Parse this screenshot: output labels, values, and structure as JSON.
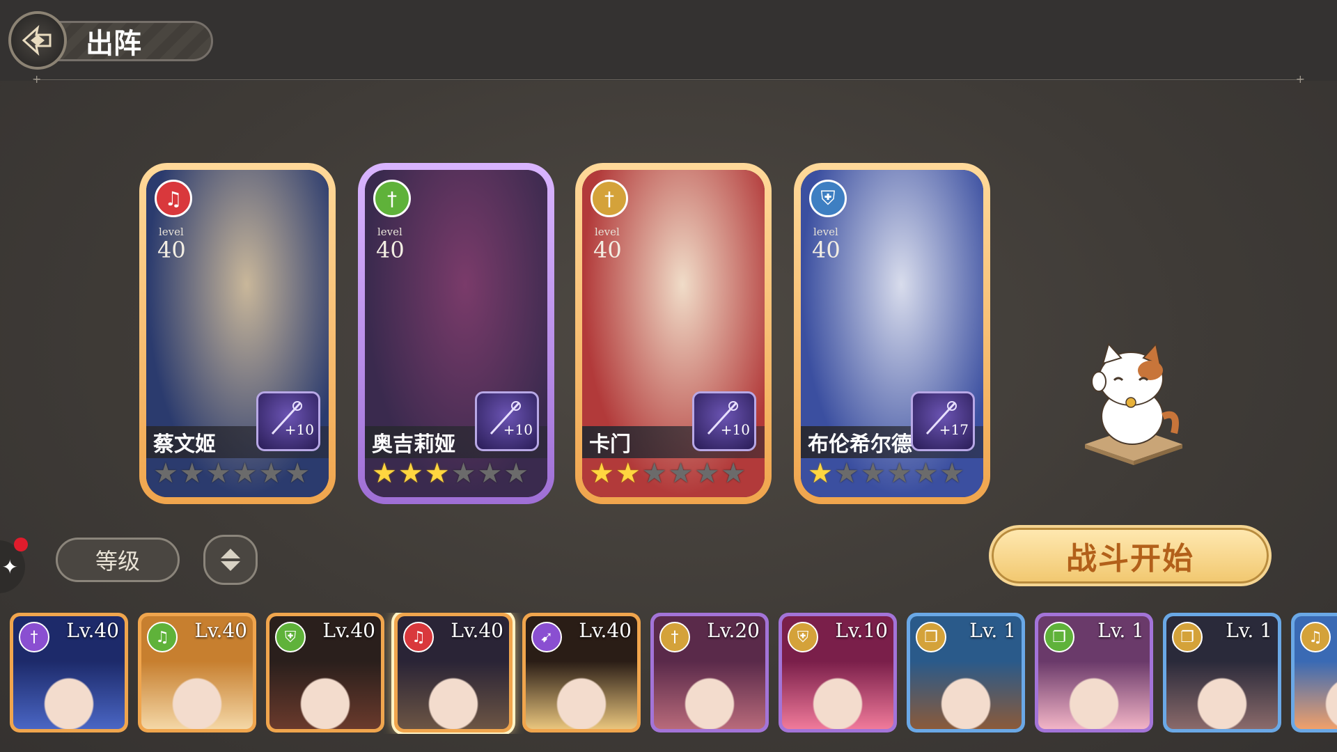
{
  "header": {
    "title": "出阵"
  },
  "team": [
    {
      "name": "蔡文姬",
      "level_word": "level",
      "level": "40",
      "class_icon": "lyre-icon",
      "class_color": "#d9383c",
      "frame": "gold",
      "weapon_plus": "+10",
      "stars_on": 0,
      "stars_total": 6,
      "art": [
        "#2b3b6e",
        "#c9b79a"
      ]
    },
    {
      "name": "奥吉莉娅",
      "level_word": "level",
      "level": "40",
      "class_icon": "sword-icon",
      "class_color": "#5fb23a",
      "frame": "purple",
      "weapon_plus": "+10",
      "stars_on": 3,
      "stars_total": 6,
      "art": [
        "#3a2a4e",
        "#7a3b6a"
      ]
    },
    {
      "name": "卡门",
      "level_word": "level",
      "level": "40",
      "class_icon": "sword-icon",
      "class_color": "#d4a23a",
      "frame": "gold",
      "weapon_plus": "+10",
      "stars_on": 2,
      "stars_total": 6,
      "art": [
        "#b23a3a",
        "#f0dcc8"
      ]
    },
    {
      "name": "布伦希尔德",
      "level_word": "level",
      "level": "40",
      "class_icon": "shield-icon",
      "class_color": "#3e7fc2",
      "frame": "gold",
      "weapon_plus": "+17",
      "stars_on": 1,
      "stars_total": 6,
      "art": [
        "#3b4fa0",
        "#d8dcec"
      ]
    }
  ],
  "controls": {
    "sort_label": "等级",
    "battle_label": "战斗开始"
  },
  "roster": [
    {
      "level": "Lv.40",
      "icon": "sword-icon",
      "icon_color": "#8a4fd1",
      "frame": "gold",
      "art": [
        "#1d2a6a",
        "#4a66c4"
      ]
    },
    {
      "level": "Lv.40",
      "icon": "lyre-icon",
      "icon_color": "#5fb23a",
      "frame": "gold",
      "art": [
        "#c77f2f",
        "#f4d7a6"
      ]
    },
    {
      "level": "Lv.40",
      "icon": "shield-icon",
      "icon_color": "#5fb23a",
      "frame": "gold",
      "art": [
        "#2a1f1c",
        "#6a3a2c"
      ]
    },
    {
      "level": "Lv.40",
      "icon": "lyre-icon",
      "icon_color": "#d9383c",
      "frame": "gold",
      "art": [
        "#2a2436",
        "#6c5544"
      ],
      "selected": true
    },
    {
      "level": "Lv.40",
      "icon": "bow-icon",
      "icon_color": "#8a4fd1",
      "frame": "gold",
      "art": [
        "#2a1d16",
        "#e9c57d"
      ]
    },
    {
      "level": "Lv.20",
      "icon": "sword-icon",
      "icon_color": "#d4a23a",
      "frame": "purple",
      "art": [
        "#5a2a4a",
        "#b86a7a"
      ]
    },
    {
      "level": "Lv.10",
      "icon": "shield-icon",
      "icon_color": "#d4a23a",
      "frame": "purple",
      "art": [
        "#7a1f4a",
        "#f07a9a"
      ]
    },
    {
      "level": "Lv. 1",
      "icon": "book-icon",
      "icon_color": "#d4a23a",
      "frame": "blue",
      "art": [
        "#2a5a8a",
        "#8a5a3a"
      ]
    },
    {
      "level": "Lv. 1",
      "icon": "book-icon",
      "icon_color": "#5fb23a",
      "frame": "purple",
      "art": [
        "#6a3a6a",
        "#f2b4c6"
      ]
    },
    {
      "level": "Lv. 1",
      "icon": "book-icon",
      "icon_color": "#d4a23a",
      "frame": "blue",
      "art": [
        "#2a2a3a",
        "#8a6a6a"
      ]
    },
    {
      "level": "",
      "icon": "lyre-icon",
      "icon_color": "#d4a23a",
      "frame": "blue",
      "art": [
        "#3a6ab4",
        "#f0a06a"
      ]
    }
  ]
}
